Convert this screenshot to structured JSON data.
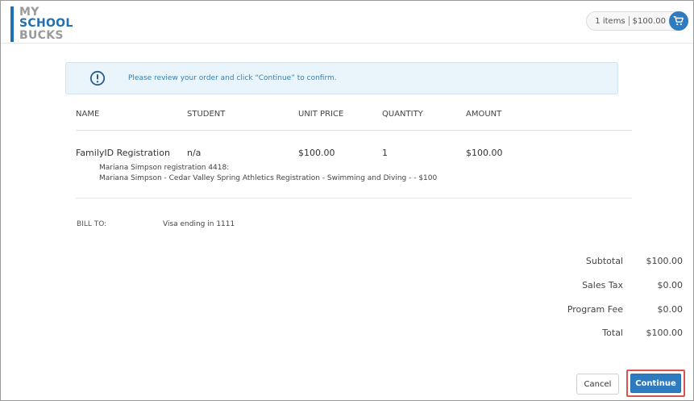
{
  "header": {
    "logo": {
      "line1": "MY",
      "line2": "SCHOOL",
      "line3": "BUCKS"
    },
    "cart": {
      "items_text": "1 items",
      "amount": "$100.00",
      "icon": "cart-icon"
    }
  },
  "alert": {
    "icon": "exclamation-circle-icon",
    "message": "Please review your order and click “Continue” to confirm."
  },
  "table": {
    "headers": [
      "NAME",
      "STUDENT",
      "UNIT PRICE",
      "QUANTITY",
      "AMOUNT"
    ],
    "rows": [
      {
        "name": "FamilyID Registration",
        "student": "n/a",
        "unit_price": "$100.00",
        "quantity": "1",
        "amount": "$100.00",
        "details": [
          "Mariana Simpson registration 4418:",
          "Mariana Simpson - Cedar Valley Spring Athletics Registration - Swimming and Diving - - $100"
        ]
      }
    ]
  },
  "billing": {
    "label": "BILL TO:",
    "value": "Visa ending in 1111"
  },
  "totals": [
    {
      "label": "Subtotal",
      "value": "$100.00"
    },
    {
      "label": "Sales Tax",
      "value": "$0.00"
    },
    {
      "label": "Program Fee",
      "value": "$0.00"
    },
    {
      "label": "Total",
      "value": "$100.00"
    }
  ],
  "actions": {
    "cancel_label": "Cancel",
    "continue_label": "Continue"
  },
  "colors": {
    "brand_blue": "#1f6fb5",
    "button_blue": "#2f7bbf",
    "alert_bg": "#eaf4fb",
    "highlight_red": "#d9534f"
  }
}
